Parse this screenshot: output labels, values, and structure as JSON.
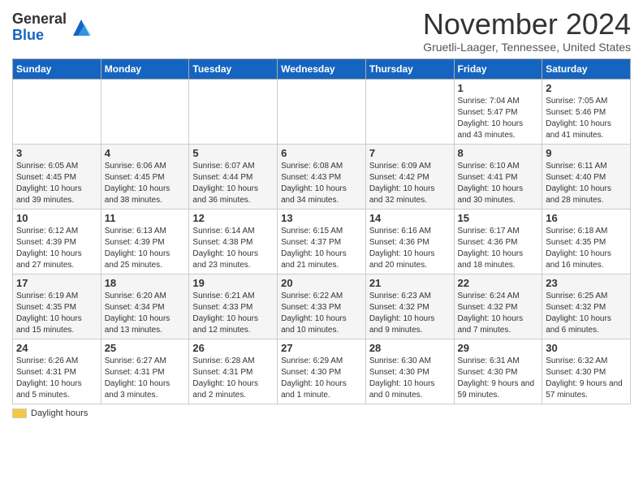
{
  "logo": {
    "general": "General",
    "blue": "Blue"
  },
  "header": {
    "title": "November 2024",
    "location": "Gruetli-Laager, Tennessee, United States"
  },
  "days_of_week": [
    "Sunday",
    "Monday",
    "Tuesday",
    "Wednesday",
    "Thursday",
    "Friday",
    "Saturday"
  ],
  "weeks": [
    [
      {
        "num": "",
        "info": ""
      },
      {
        "num": "",
        "info": ""
      },
      {
        "num": "",
        "info": ""
      },
      {
        "num": "",
        "info": ""
      },
      {
        "num": "",
        "info": ""
      },
      {
        "num": "1",
        "info": "Sunrise: 7:04 AM\nSunset: 5:47 PM\nDaylight: 10 hours\nand 43 minutes."
      },
      {
        "num": "2",
        "info": "Sunrise: 7:05 AM\nSunset: 5:46 PM\nDaylight: 10 hours\nand 41 minutes."
      }
    ],
    [
      {
        "num": "3",
        "info": "Sunrise: 6:05 AM\nSunset: 4:45 PM\nDaylight: 10 hours\nand 39 minutes."
      },
      {
        "num": "4",
        "info": "Sunrise: 6:06 AM\nSunset: 4:45 PM\nDaylight: 10 hours\nand 38 minutes."
      },
      {
        "num": "5",
        "info": "Sunrise: 6:07 AM\nSunset: 4:44 PM\nDaylight: 10 hours\nand 36 minutes."
      },
      {
        "num": "6",
        "info": "Sunrise: 6:08 AM\nSunset: 4:43 PM\nDaylight: 10 hours\nand 34 minutes."
      },
      {
        "num": "7",
        "info": "Sunrise: 6:09 AM\nSunset: 4:42 PM\nDaylight: 10 hours\nand 32 minutes."
      },
      {
        "num": "8",
        "info": "Sunrise: 6:10 AM\nSunset: 4:41 PM\nDaylight: 10 hours\nand 30 minutes."
      },
      {
        "num": "9",
        "info": "Sunrise: 6:11 AM\nSunset: 4:40 PM\nDaylight: 10 hours\nand 28 minutes."
      }
    ],
    [
      {
        "num": "10",
        "info": "Sunrise: 6:12 AM\nSunset: 4:39 PM\nDaylight: 10 hours\nand 27 minutes."
      },
      {
        "num": "11",
        "info": "Sunrise: 6:13 AM\nSunset: 4:39 PM\nDaylight: 10 hours\nand 25 minutes."
      },
      {
        "num": "12",
        "info": "Sunrise: 6:14 AM\nSunset: 4:38 PM\nDaylight: 10 hours\nand 23 minutes."
      },
      {
        "num": "13",
        "info": "Sunrise: 6:15 AM\nSunset: 4:37 PM\nDaylight: 10 hours\nand 21 minutes."
      },
      {
        "num": "14",
        "info": "Sunrise: 6:16 AM\nSunset: 4:36 PM\nDaylight: 10 hours\nand 20 minutes."
      },
      {
        "num": "15",
        "info": "Sunrise: 6:17 AM\nSunset: 4:36 PM\nDaylight: 10 hours\nand 18 minutes."
      },
      {
        "num": "16",
        "info": "Sunrise: 6:18 AM\nSunset: 4:35 PM\nDaylight: 10 hours\nand 16 minutes."
      }
    ],
    [
      {
        "num": "17",
        "info": "Sunrise: 6:19 AM\nSunset: 4:35 PM\nDaylight: 10 hours\nand 15 minutes."
      },
      {
        "num": "18",
        "info": "Sunrise: 6:20 AM\nSunset: 4:34 PM\nDaylight: 10 hours\nand 13 minutes."
      },
      {
        "num": "19",
        "info": "Sunrise: 6:21 AM\nSunset: 4:33 PM\nDaylight: 10 hours\nand 12 minutes."
      },
      {
        "num": "20",
        "info": "Sunrise: 6:22 AM\nSunset: 4:33 PM\nDaylight: 10 hours\nand 10 minutes."
      },
      {
        "num": "21",
        "info": "Sunrise: 6:23 AM\nSunset: 4:32 PM\nDaylight: 10 hours\nand 9 minutes."
      },
      {
        "num": "22",
        "info": "Sunrise: 6:24 AM\nSunset: 4:32 PM\nDaylight: 10 hours\nand 7 minutes."
      },
      {
        "num": "23",
        "info": "Sunrise: 6:25 AM\nSunset: 4:32 PM\nDaylight: 10 hours\nand 6 minutes."
      }
    ],
    [
      {
        "num": "24",
        "info": "Sunrise: 6:26 AM\nSunset: 4:31 PM\nDaylight: 10 hours\nand 5 minutes."
      },
      {
        "num": "25",
        "info": "Sunrise: 6:27 AM\nSunset: 4:31 PM\nDaylight: 10 hours\nand 3 minutes."
      },
      {
        "num": "26",
        "info": "Sunrise: 6:28 AM\nSunset: 4:31 PM\nDaylight: 10 hours\nand 2 minutes."
      },
      {
        "num": "27",
        "info": "Sunrise: 6:29 AM\nSunset: 4:30 PM\nDaylight: 10 hours\nand 1 minute."
      },
      {
        "num": "28",
        "info": "Sunrise: 6:30 AM\nSunset: 4:30 PM\nDaylight: 10 hours\nand 0 minutes."
      },
      {
        "num": "29",
        "info": "Sunrise: 6:31 AM\nSunset: 4:30 PM\nDaylight: 9 hours\nand 59 minutes."
      },
      {
        "num": "30",
        "info": "Sunrise: 6:32 AM\nSunset: 4:30 PM\nDaylight: 9 hours\nand 57 minutes."
      }
    ]
  ],
  "footer": {
    "swatch_label": "Daylight hours"
  }
}
